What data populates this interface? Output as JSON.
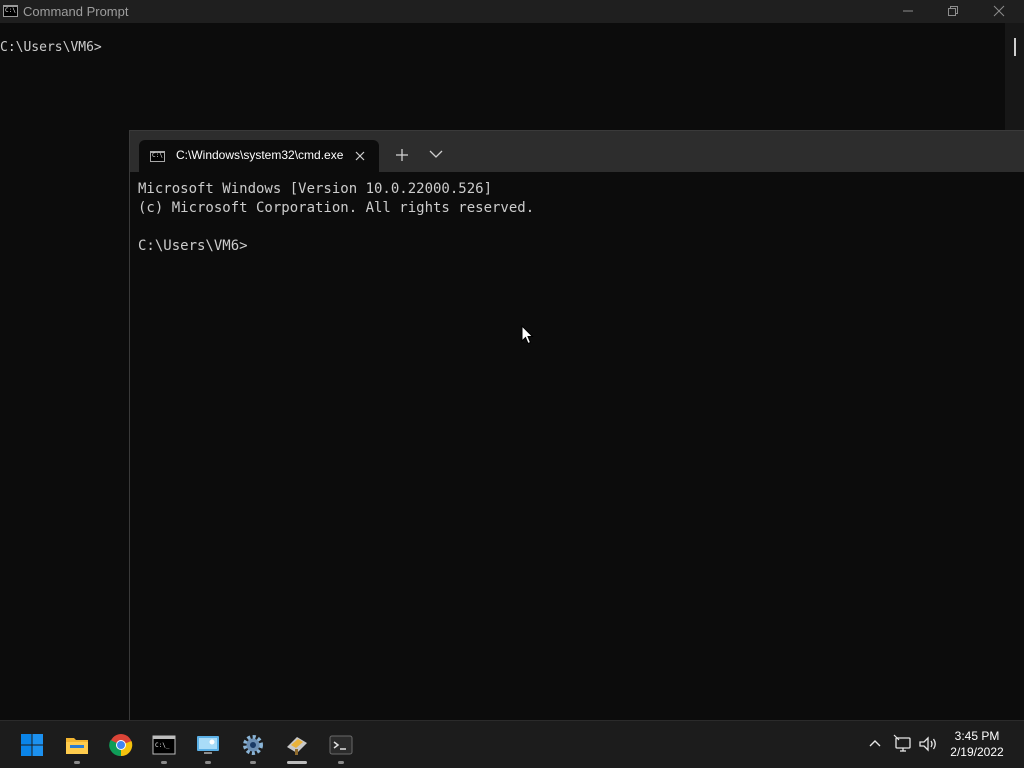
{
  "back_window": {
    "title": "Command Prompt",
    "prompt": "C:\\Users\\VM6>",
    "icon": "console-icon"
  },
  "terminal": {
    "tab_title": "C:\\Windows\\system32\\cmd.exe",
    "lines": [
      "Microsoft Windows [Version 10.0.22000.526]",
      "(c) Microsoft Corporation. All rights reserved."
    ],
    "prompt": "C:\\Users\\VM6>"
  },
  "taskbar": {
    "apps": [
      "windows-start-icon",
      "file-explorer-icon",
      "chrome-icon",
      "command-prompt-icon",
      "remote-desktop-icon",
      "settings-gear-icon",
      "file-transfer-icon",
      "terminal-icon"
    ],
    "tray": [
      "chevron-up-icon",
      "network-icon",
      "volume-icon"
    ]
  },
  "clock": {
    "time": "3:45 PM",
    "date": "2/19/2022"
  },
  "colors": {
    "console_bg": "#0c0c0c",
    "text": "#cccccc",
    "titlebar": "#1f1f1f",
    "taskbar": "#1c1c1c",
    "windows_blue": "#0078d4"
  }
}
